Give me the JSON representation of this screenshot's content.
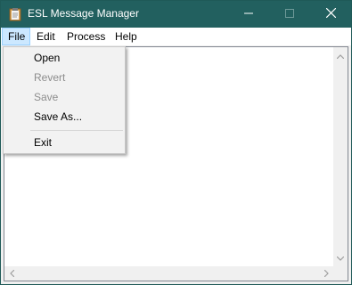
{
  "window": {
    "title": "ESL Message Manager"
  },
  "menubar": {
    "items": [
      {
        "label": "File"
      },
      {
        "label": "Edit"
      },
      {
        "label": "Process"
      },
      {
        "label": "Help"
      }
    ]
  },
  "file_menu": {
    "items": [
      {
        "label": "Open",
        "enabled": true
      },
      {
        "label": "Revert",
        "enabled": false
      },
      {
        "label": "Save",
        "enabled": false
      },
      {
        "label": "Save As...",
        "enabled": true
      },
      {
        "label": "Exit",
        "enabled": true
      }
    ]
  },
  "colors": {
    "titlebar": "#22605f",
    "menu_highlight": "#cce8ff",
    "disabled_text": "#8d8d8d"
  },
  "icons": {
    "app": "clipboard-icon",
    "minimize": "minimize-icon",
    "maximize": "maximize-icon",
    "close": "close-icon"
  }
}
